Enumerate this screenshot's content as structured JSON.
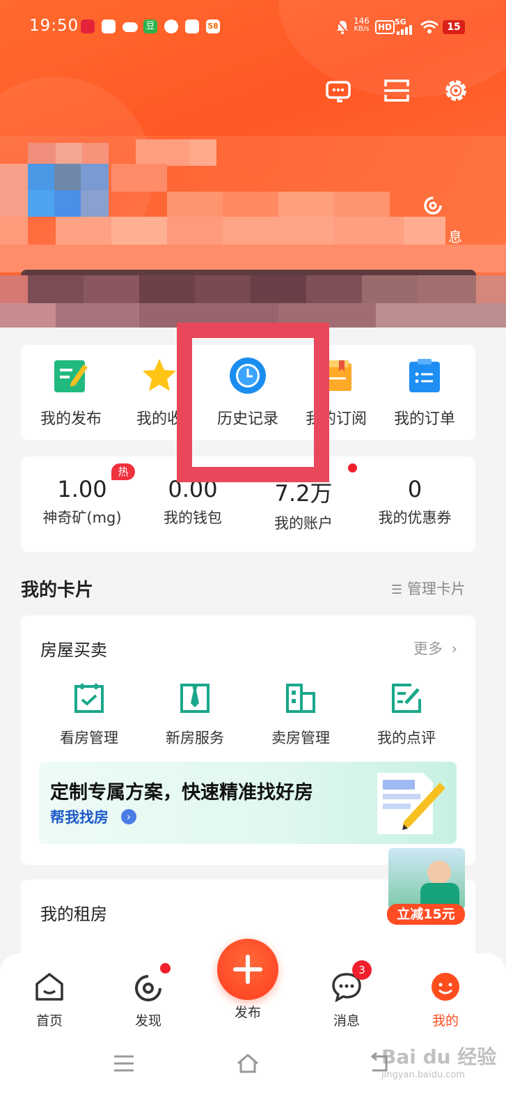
{
  "status_bar": {
    "time": "19:50",
    "net_speed": "146",
    "net_unit": "KB/s",
    "hd": "HD",
    "signal": "5G",
    "battery": "15"
  },
  "header": {
    "icons": [
      "customer-service-icon",
      "scan-icon",
      "settings-icon"
    ],
    "side_label": "息"
  },
  "quick_actions": [
    {
      "label": "我的发布",
      "icon": "edit-note-icon"
    },
    {
      "label": "我的收",
      "icon": "star-icon"
    },
    {
      "label": "历史记录",
      "icon": "clock-icon"
    },
    {
      "label": "我的订阅",
      "icon": "subscribe-icon"
    },
    {
      "label": "我的订单",
      "icon": "order-icon"
    }
  ],
  "stats": [
    {
      "value": "1.00",
      "label": "神奇矿(mg)"
    },
    {
      "value": "0.00",
      "label": "我的钱包"
    },
    {
      "value": "7.2万",
      "label": "我的账户"
    },
    {
      "value": "0",
      "label": "我的优惠券"
    }
  ],
  "hot_badge": "热",
  "cards_section": {
    "title": "我的卡片",
    "manage": "管理卡片"
  },
  "house_card": {
    "title": "房屋买卖",
    "more": "更多",
    "services": [
      {
        "label": "看房管理",
        "icon": "calendar-check-icon"
      },
      {
        "label": "新房服务",
        "icon": "tie-icon"
      },
      {
        "label": "卖房管理",
        "icon": "building-icon"
      },
      {
        "label": "我的点评",
        "icon": "review-edit-icon"
      }
    ],
    "banner": {
      "title": "定制专属方案，快速精准找好房",
      "link": "帮我找房"
    }
  },
  "rent_card": {
    "title": "我的租房"
  },
  "promo": {
    "tag": "立减15元"
  },
  "bottom_nav": [
    {
      "label": "首页",
      "icon": "home-icon"
    },
    {
      "label": "发现",
      "icon": "discover-icon"
    },
    {
      "label": "发布",
      "icon": "plus-icon"
    },
    {
      "label": "消息",
      "icon": "message-icon"
    },
    {
      "label": "我的",
      "icon": "profile-icon"
    }
  ],
  "message_badge": "3",
  "colors": {
    "accent": "#ff5724",
    "highlight": "#e8485a",
    "link": "#1d59c9",
    "icon_green": "#1aa78b"
  },
  "watermark": {
    "main": "Bai du 经验",
    "sub": "jingyan.baidu.com"
  }
}
